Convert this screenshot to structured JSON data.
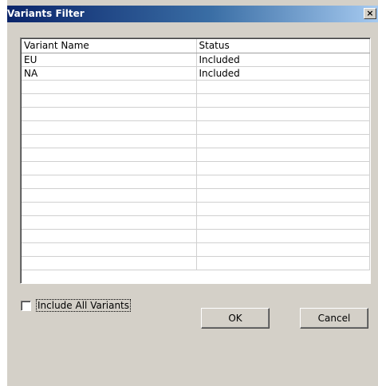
{
  "window": {
    "title": "Variants Filter",
    "close_glyph": "×"
  },
  "grid": {
    "columns": [
      "Variant Name",
      "Status"
    ],
    "rows": [
      [
        "EU",
        "Included"
      ],
      [
        "NA",
        "Included"
      ],
      [
        "",
        ""
      ],
      [
        "",
        ""
      ],
      [
        "",
        ""
      ],
      [
        "",
        ""
      ],
      [
        "",
        ""
      ],
      [
        "",
        ""
      ],
      [
        "",
        ""
      ],
      [
        "",
        ""
      ],
      [
        "",
        ""
      ],
      [
        "",
        ""
      ],
      [
        "",
        ""
      ],
      [
        "",
        ""
      ],
      [
        "",
        ""
      ],
      [
        "",
        ""
      ]
    ]
  },
  "include_all": {
    "label": "Include All Variants",
    "checked": false
  },
  "buttons": {
    "ok": "OK",
    "cancel": "Cancel"
  }
}
